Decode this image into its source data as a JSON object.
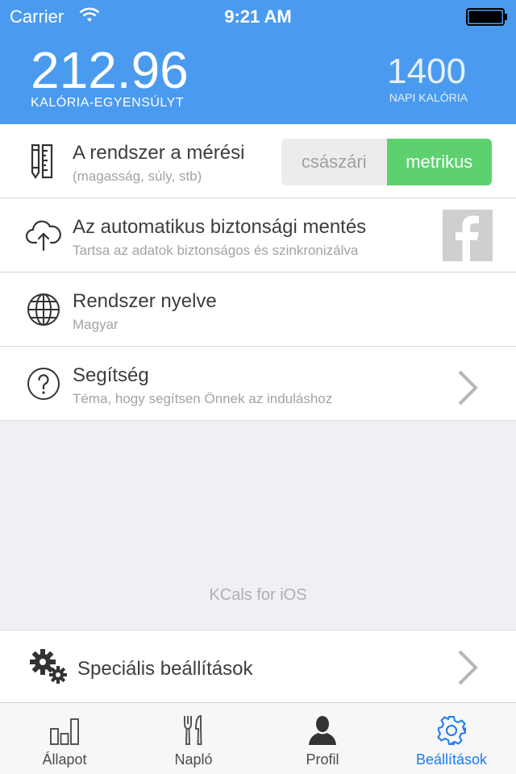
{
  "status_bar": {
    "carrier": "Carrier",
    "time": "9:21 AM"
  },
  "header": {
    "balance_value": "212.96",
    "balance_label": "KALÓRIA-EGYENSÚLYT",
    "daily_value": "1400",
    "daily_label": "NAPI KALÓRIA"
  },
  "settings": {
    "measurement": {
      "title": "A rendszer a mérési",
      "subtitle": "(magasság, súly, stb)",
      "options": [
        "császári",
        "metrikus"
      ],
      "selected": "metrikus"
    },
    "backup": {
      "title": "Az automatikus biztonsági mentés",
      "subtitle": "Tartsa az adatok biztonságos és szinkronizálva",
      "button_icon": "facebook-icon"
    },
    "language": {
      "title": "Rendszer nyelve",
      "subtitle": "Magyar"
    },
    "help": {
      "title": "Segítség",
      "subtitle": "Téma, hogy segítsen Önnek az induláshoz"
    }
  },
  "footer_text": "KCals for iOS",
  "special": {
    "label": "Speciális beállítások"
  },
  "tabs": [
    {
      "label": "Állapot",
      "icon": "bar-chart-icon"
    },
    {
      "label": "Napló",
      "icon": "cutlery-icon"
    },
    {
      "label": "Profil",
      "icon": "person-icon"
    },
    {
      "label": "Beállítások",
      "icon": "gear-icon"
    }
  ],
  "active_tab": "Beállítások",
  "colors": {
    "header": "#4a9bef",
    "selected_segment": "#5dd16f",
    "active_tab": "#1a7bf3"
  }
}
